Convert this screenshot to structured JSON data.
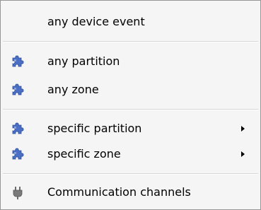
{
  "menu": {
    "items": [
      {
        "label": "any device event",
        "icon": "",
        "submenu": false
      },
      {
        "label": "any partition",
        "icon": "puzzle-piece-icon",
        "submenu": false
      },
      {
        "label": "any zone",
        "icon": "puzzle-piece-icon",
        "submenu": false
      },
      {
        "label": "specific partition",
        "icon": "puzzle-piece-icon",
        "submenu": true
      },
      {
        "label": "specific zone",
        "icon": "puzzle-piece-icon",
        "submenu": true
      },
      {
        "label": "Communication channels",
        "icon": "plug-icon",
        "submenu": false
      }
    ]
  },
  "colors": {
    "menu_background": "#f5f5f5",
    "menu_border": "#979797",
    "puzzle_icon": "#4a6fc4",
    "plug_icon": "#6d6d6d"
  }
}
